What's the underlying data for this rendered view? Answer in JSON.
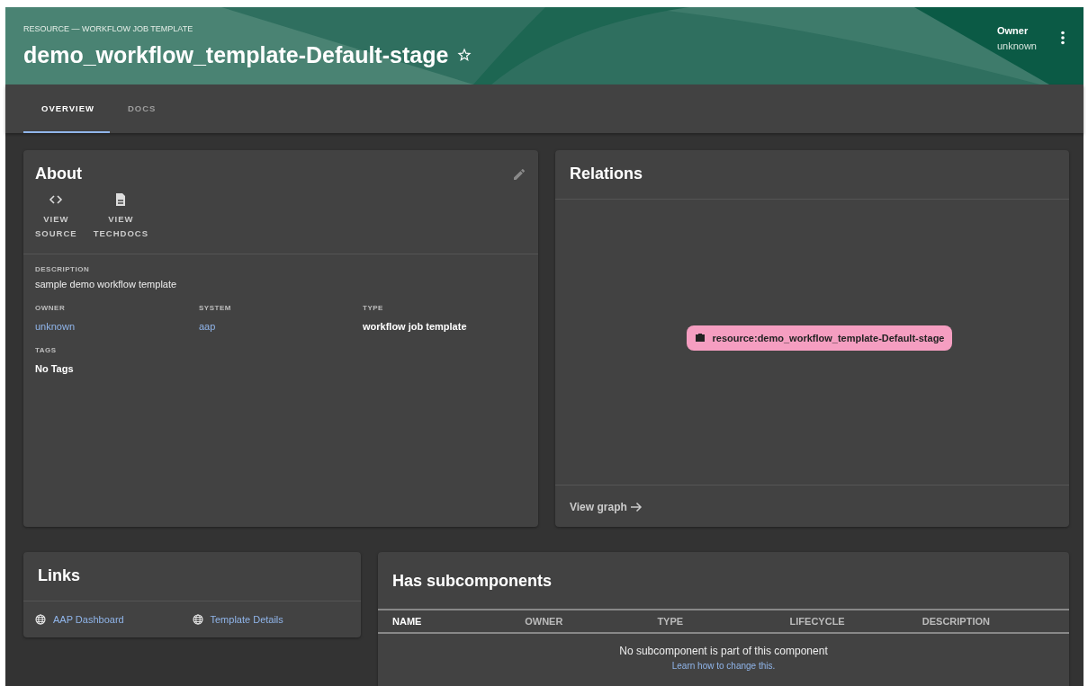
{
  "header": {
    "subtitle": "RESOURCE — WORKFLOW JOB TEMPLATE",
    "title": "demo_workflow_template-Default-stage",
    "starred": false,
    "owner_label": "Owner",
    "owner_value": "unknown"
  },
  "tabs": [
    {
      "label": "OVERVIEW",
      "selected": true
    },
    {
      "label": "DOCS",
      "selected": false
    }
  ],
  "about": {
    "title": "About",
    "actions": [
      {
        "kind": "source",
        "line1": "VIEW",
        "line2": "SOURCE"
      },
      {
        "kind": "docs",
        "line1": "VIEW",
        "line2": "TECHDOCS"
      }
    ],
    "description_label": "DESCRIPTION",
    "description": "sample demo workflow template",
    "fields": [
      {
        "label": "OWNER",
        "value": "unknown",
        "kind": "link"
      },
      {
        "label": "SYSTEM",
        "value": "aap",
        "kind": "link"
      },
      {
        "label": "TYPE",
        "value": "workflow job template",
        "kind": "text"
      }
    ],
    "tags_label": "TAGS",
    "tags_value": "No Tags"
  },
  "relations": {
    "title": "Relations",
    "node": "resource:demo_workflow_template-Default-stage",
    "footer_link": "View graph"
  },
  "links": {
    "title": "Links",
    "items": [
      {
        "label": "AAP Dashboard"
      },
      {
        "label": "Template Details"
      }
    ]
  },
  "subcomponents": {
    "title": "Has subcomponents",
    "columns": [
      "NAME",
      "OWNER",
      "TYPE",
      "LIFECYCLE",
      "DESCRIPTION"
    ],
    "empty_text": "No subcomponent is part of this component",
    "help_link": "Learn how to change this."
  }
}
